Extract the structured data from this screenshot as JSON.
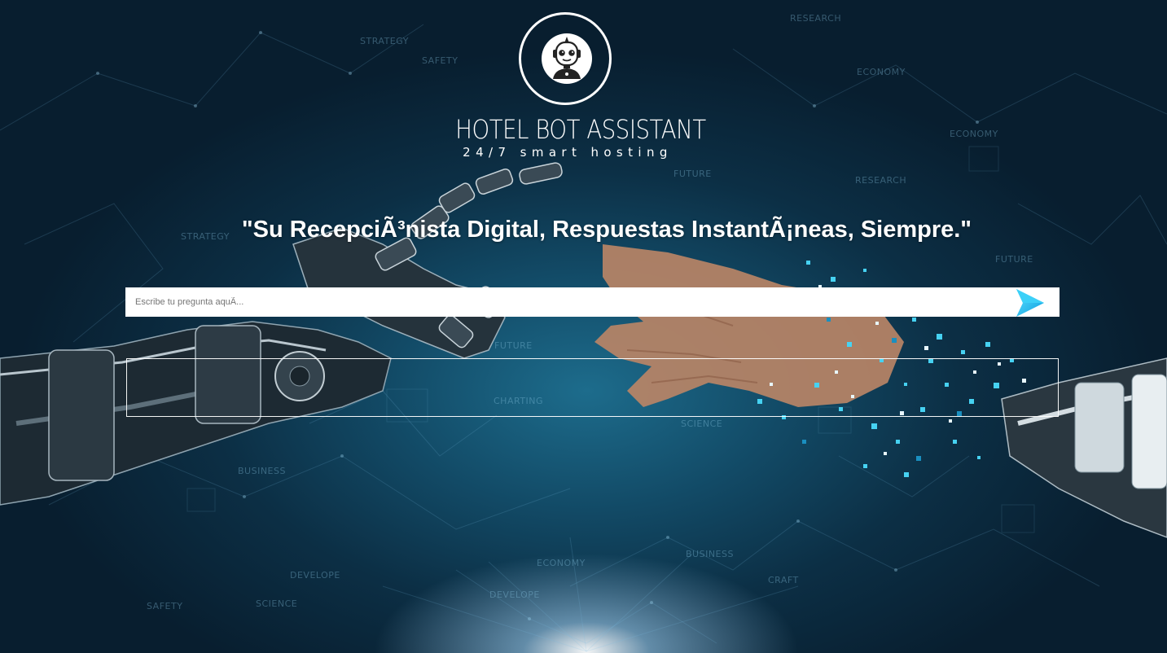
{
  "brand": {
    "title": "HOTEL BOT ASSISTANT",
    "tagline": "24/7 smart hosting",
    "logo_icon": "robot-icon"
  },
  "headline": "\"Su RecepciÃ³nista Digital, Respuestas InstantÃ¡neas, Siempre.\"",
  "search": {
    "placeholder": "Escribe tu pregunta aquÃ...",
    "value": "",
    "send_icon": "send-arrow-icon"
  },
  "response": {
    "text": ""
  },
  "background_words": [
    "STRATEGY",
    "SAFETY",
    "ECONOMY",
    "BUSINESS",
    "FUTURE",
    "RESEARCH",
    "SCIENCE",
    "DEVELOPE",
    "CRAFT",
    "ECONOMY",
    "FUTURE",
    "STRATEGY",
    "BUSINESS",
    "SCIENCE",
    "DEVELOPE",
    "SAFETY",
    "ECONOMY",
    "RESEARCH",
    "CHARTING",
    "FUTURE"
  ],
  "colors": {
    "background_dark": "#081e2f",
    "background_mid": "#124a66",
    "accent_cyan": "#1ec8f0",
    "text": "#ffffff"
  }
}
